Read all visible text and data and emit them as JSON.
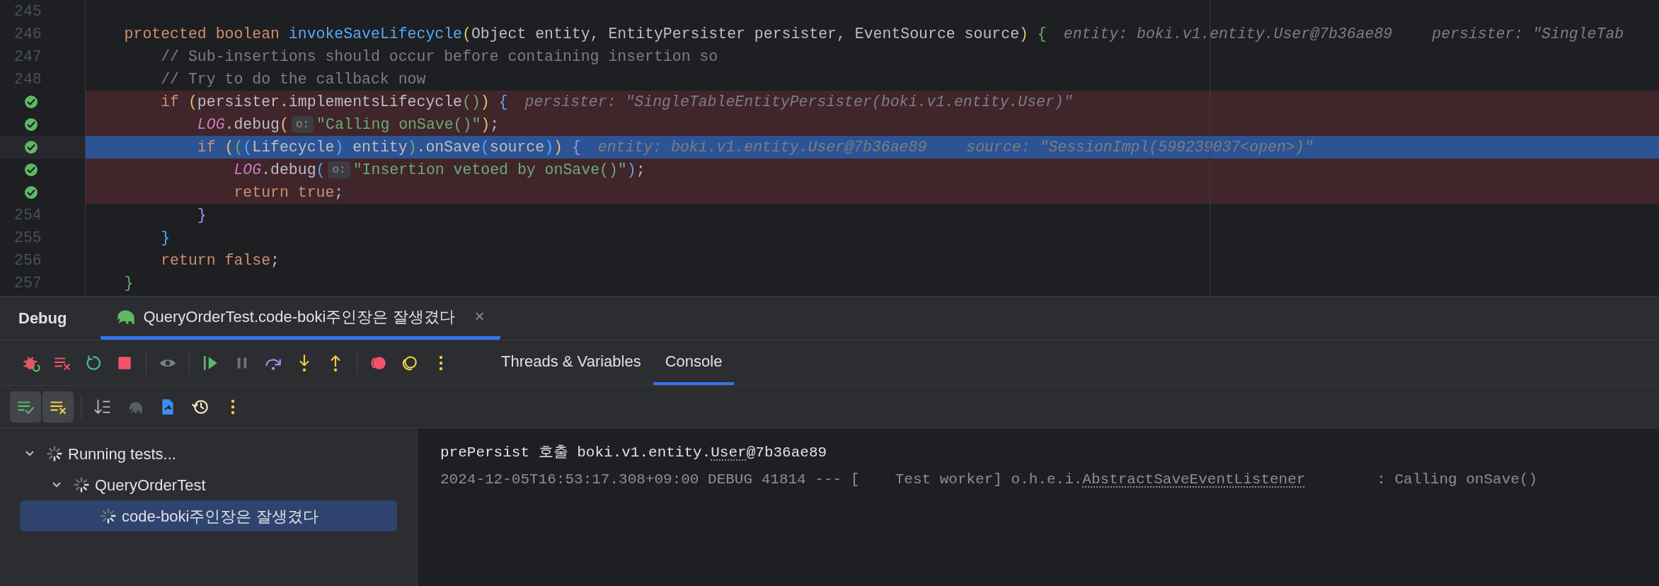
{
  "editor": {
    "lines": [
      {
        "number": "245",
        "breakpoint": false,
        "kind": "plain"
      },
      {
        "number": "246",
        "breakpoint": false,
        "kind": "plain",
        "tokens": [
          {
            "text": "    protected boolean ",
            "kind": "kw"
          },
          {
            "text": "invokeSaveLifecycle",
            "kind": "fn"
          },
          {
            "text": "(",
            "kind": "y"
          },
          {
            "text": "Object entity, EntityPersister persister, EventSource source",
            "kind": "tx"
          },
          {
            "text": ")",
            "kind": "y"
          },
          {
            "text": " {",
            "kind": "g"
          },
          {
            "text": "entity: boki.v1.entity.User@7b36ae89",
            "kind": "hint"
          },
          {
            "text": "persister: \"SingleTab",
            "kind": "hint"
          }
        ]
      },
      {
        "number": "247",
        "breakpoint": false,
        "kind": "plain",
        "tokens": [
          {
            "text": "        // Sub-insertions should occur before containing insertion so",
            "kind": "cm"
          }
        ]
      },
      {
        "number": "248",
        "breakpoint": false,
        "kind": "plain",
        "tokens": [
          {
            "text": "        // Try to do the callback now",
            "kind": "cm"
          }
        ]
      },
      {
        "breakpoint": true,
        "kind": "hit",
        "tokens": [
          {
            "text": "        if ",
            "kind": "kw"
          },
          {
            "text": "(",
            "kind": "y"
          },
          {
            "text": "persister.implementsLifecycle",
            "kind": "tx"
          },
          {
            "text": "()",
            "kind": "g"
          },
          {
            "text": ")",
            "kind": "y"
          },
          {
            "text": " {",
            "kind": "b"
          },
          {
            "text": "persister: \"SingleTableEntityPersister(boki.v1.entity.User)\"",
            "kind": "hint"
          }
        ]
      },
      {
        "breakpoint": true,
        "kind": "hit",
        "tokens": [
          {
            "text": "            LOG",
            "kind": "sf"
          },
          {
            "text": ".debug",
            "kind": "tx"
          },
          {
            "text": "(",
            "kind": "y"
          },
          {
            "text": "o:",
            "kind": "inlay"
          },
          {
            "text": "\"Calling onSave()\"",
            "kind": "st"
          },
          {
            "text": ")",
            "kind": "y"
          },
          {
            "text": ";",
            "kind": "tx"
          }
        ]
      },
      {
        "breakpoint": true,
        "kind": "current",
        "tokens": [
          {
            "text": "            if ",
            "kind": "kw"
          },
          {
            "text": "(",
            "kind": "y"
          },
          {
            "text": "(",
            "kind": "g"
          },
          {
            "text": "(",
            "kind": "b"
          },
          {
            "text": "Lifecycle",
            "kind": "tx"
          },
          {
            "text": ")",
            "kind": "b"
          },
          {
            "text": " entity",
            "kind": "tx"
          },
          {
            "text": ")",
            "kind": "g"
          },
          {
            "text": ".onSave",
            "kind": "tx"
          },
          {
            "text": "(",
            "kind": "b"
          },
          {
            "text": "source",
            "kind": "tx"
          },
          {
            "text": ")",
            "kind": "b"
          },
          {
            "text": ")",
            "kind": "y"
          },
          {
            "text": " {",
            "kind": "p"
          },
          {
            "text": "entity: boki.v1.entity.User@7b36ae89",
            "kind": "hint"
          },
          {
            "text": "source: \"SessionImpl(599239037<open>)\"",
            "kind": "hint"
          }
        ]
      },
      {
        "breakpoint": true,
        "kind": "hit",
        "tokens": [
          {
            "text": "                LOG",
            "kind": "sf"
          },
          {
            "text": ".debug",
            "kind": "tx"
          },
          {
            "text": "(",
            "kind": "b"
          },
          {
            "text": "o:",
            "kind": "inlay"
          },
          {
            "text": "\"Insertion vetoed by onSave()\"",
            "kind": "st"
          },
          {
            "text": ")",
            "kind": "b"
          },
          {
            "text": ";",
            "kind": "tx"
          }
        ]
      },
      {
        "breakpoint": true,
        "kind": "hit",
        "tokens": [
          {
            "text": "                return true",
            "kind": "kw"
          },
          {
            "text": ";",
            "kind": "tx"
          }
        ]
      },
      {
        "number": "254",
        "breakpoint": false,
        "kind": "plain",
        "tokens": [
          {
            "text": "            }",
            "kind": "p"
          }
        ]
      },
      {
        "number": "255",
        "breakpoint": false,
        "kind": "plain",
        "tokens": [
          {
            "text": "        }",
            "kind": "b"
          }
        ]
      },
      {
        "number": "256",
        "breakpoint": false,
        "kind": "plain",
        "tokens": [
          {
            "text": "        return false",
            "kind": "kw"
          },
          {
            "text": ";",
            "kind": "tx"
          }
        ]
      },
      {
        "number": "257",
        "breakpoint": false,
        "kind": "plain",
        "tokens": [
          {
            "text": "    }",
            "kind": "g"
          }
        ]
      }
    ]
  },
  "debug": {
    "title": "Debug",
    "session_tab": {
      "label": "QueryOrderTest.code-boki주인장은 잘생겼다",
      "close": "×",
      "selected": true
    },
    "toolbar": [
      {
        "kind": "rerun-debug"
      },
      {
        "kind": "clear"
      },
      {
        "kind": "rerun"
      },
      {
        "kind": "stop"
      },
      {
        "kind": "divider"
      },
      {
        "kind": "eye"
      },
      {
        "kind": "divider"
      },
      {
        "kind": "resume"
      },
      {
        "kind": "pause"
      },
      {
        "kind": "step-over"
      },
      {
        "kind": "step-into"
      },
      {
        "kind": "step-out"
      },
      {
        "kind": "divider"
      },
      {
        "kind": "mute"
      },
      {
        "kind": "circles"
      },
      {
        "kind": "more"
      }
    ],
    "view_tabs": [
      {
        "label": "Threads & Variables",
        "selected": false
      },
      {
        "label": "Console",
        "selected": true
      }
    ],
    "test_toolbar": [
      {
        "kind": "passed",
        "selected": true
      },
      {
        "kind": "ignored",
        "selected": true
      },
      {
        "kind": "divider"
      },
      {
        "kind": "sort",
        "selected": false
      },
      {
        "kind": "elephant",
        "selected": false
      },
      {
        "kind": "file",
        "selected": false
      },
      {
        "kind": "history",
        "selected": false
      },
      {
        "kind": "more",
        "selected": false
      }
    ],
    "tree": [
      {
        "label": "Running tests...",
        "expanded": true,
        "selected": false,
        "children": [
          {
            "label": "QueryOrderTest",
            "expanded": true,
            "selected": false,
            "children": [
              {
                "label": "code-boki주인장은 잘생겼다",
                "selected": true
              }
            ]
          }
        ]
      }
    ],
    "console": [
      {
        "kind": "output",
        "parts": [
          {
            "text": "prePersist 호출 boki.v1.entity.",
            "link": false
          },
          {
            "text": "User",
            "link": true
          },
          {
            "text": "@7b36ae89",
            "link": false
          }
        ]
      },
      {
        "kind": "log",
        "parts": [
          {
            "text": "2024-12-05T16:53:17.308+09:00 DEBUG 41814 --- [    Test worker] o.h.e.i.",
            "link": false
          },
          {
            "text": "AbstractSaveEventListener",
            "link": true
          },
          {
            "text": "        : Calling onSave()",
            "link": false
          }
        ]
      }
    ]
  }
}
